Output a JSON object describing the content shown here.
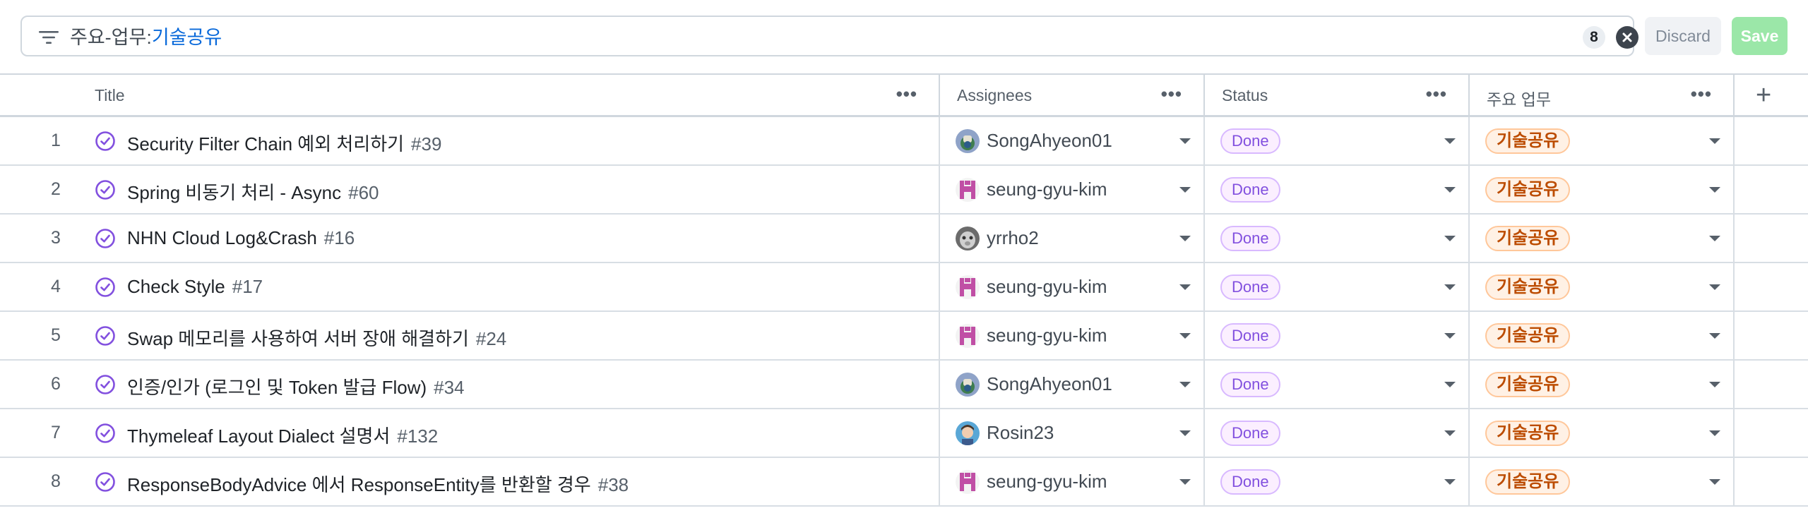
{
  "filter": {
    "key": "주요-업무:",
    "value": "기술공유",
    "count": "8",
    "discard_label": "Discard",
    "save_label": "Save"
  },
  "columns": {
    "title": "Title",
    "assignees": "Assignees",
    "status": "Status",
    "work": "주요 업무",
    "menu": "•••",
    "add": "+"
  },
  "rows": [
    {
      "n": "1",
      "title": "Security Filter Chain 예외 처리하기",
      "num": "#39",
      "assignee": "SongAhyeon01",
      "status": "Done",
      "work": "기술공유"
    },
    {
      "n": "2",
      "title": "Spring 비동기 처리 - Async",
      "num": "#60",
      "assignee": "seung-gyu-kim",
      "status": "Done",
      "work": "기술공유"
    },
    {
      "n": "3",
      "title": "NHN Cloud Log&Crash",
      "num": "#16",
      "assignee": "yrrho2",
      "status": "Done",
      "work": "기술공유"
    },
    {
      "n": "4",
      "title": "Check Style",
      "num": "#17",
      "assignee": "seung-gyu-kim",
      "status": "Done",
      "work": "기술공유"
    },
    {
      "n": "5",
      "title": "Swap 메모리를 사용하여 서버 장애 해결하기",
      "num": "#24",
      "assignee": "seung-gyu-kim",
      "status": "Done",
      "work": "기술공유"
    },
    {
      "n": "6",
      "title": "인증/인가 (로그인 및 Token 발급 Flow)",
      "num": "#34",
      "assignee": "SongAhyeon01",
      "status": "Done",
      "work": "기술공유"
    },
    {
      "n": "7",
      "title": "Thymeleaf Layout Dialect 설명서",
      "num": "#132",
      "assignee": "Rosin23",
      "status": "Done",
      "work": "기술공유"
    },
    {
      "n": "8",
      "title": "ResponseBodyAdvice 에서 ResponseEntity를 반환할 경우",
      "num": "#38",
      "assignee": "seung-gyu-kim",
      "status": "Done",
      "work": "기술공유"
    }
  ],
  "icons": {
    "filter": "filter-icon",
    "clear": "x-circle-icon",
    "done": "check-circle-icon",
    "caret": "chevron-down-icon"
  },
  "colors": {
    "done_purple": "#8250df",
    "work_orange": "#bc4c00",
    "link_blue": "#0969da",
    "save_green": "#9be7a8"
  }
}
